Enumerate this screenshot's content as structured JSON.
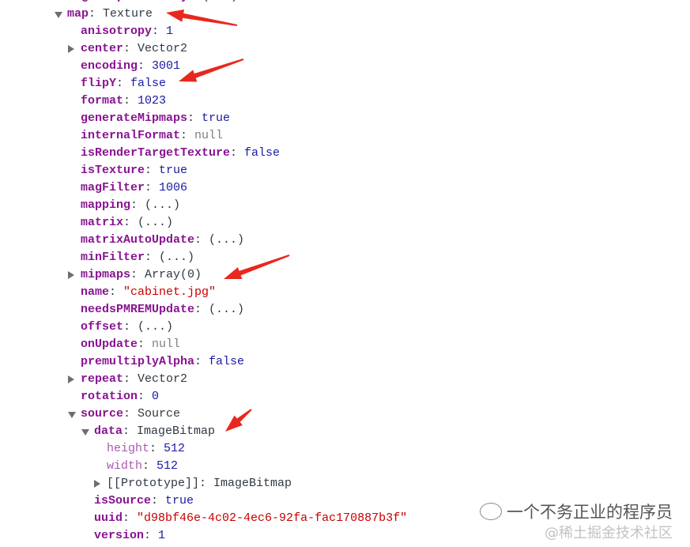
{
  "tree": [
    {
      "level": 0,
      "key": "lightMapIntensity",
      "value": "(...)",
      "type": "lazy",
      "expander": "none"
    },
    {
      "level": 0,
      "key": "map",
      "value": "Texture",
      "type": "object",
      "expander": "open"
    },
    {
      "level": 1,
      "key": "anisotropy",
      "value": "1",
      "type": "number",
      "expander": "none"
    },
    {
      "level": 1,
      "key": "center",
      "value": "Vector2",
      "type": "object",
      "expander": "closed"
    },
    {
      "level": 1,
      "key": "encoding",
      "value": "3001",
      "type": "number",
      "expander": "none"
    },
    {
      "level": 1,
      "key": "flipY",
      "value": "false",
      "type": "bool",
      "expander": "none"
    },
    {
      "level": 1,
      "key": "format",
      "value": "1023",
      "type": "number",
      "expander": "none"
    },
    {
      "level": 1,
      "key": "generateMipmaps",
      "value": "true",
      "type": "bool",
      "expander": "none"
    },
    {
      "level": 1,
      "key": "internalFormat",
      "value": "null",
      "type": "null",
      "expander": "none"
    },
    {
      "level": 1,
      "key": "isRenderTargetTexture",
      "value": "false",
      "type": "bool",
      "expander": "none"
    },
    {
      "level": 1,
      "key": "isTexture",
      "value": "true",
      "type": "bool",
      "expander": "none"
    },
    {
      "level": 1,
      "key": "magFilter",
      "value": "1006",
      "type": "number",
      "expander": "none"
    },
    {
      "level": 1,
      "key": "mapping",
      "value": "(...)",
      "type": "lazy",
      "expander": "none"
    },
    {
      "level": 1,
      "key": "matrix",
      "value": "(...)",
      "type": "lazy",
      "expander": "none"
    },
    {
      "level": 1,
      "key": "matrixAutoUpdate",
      "value": "(...)",
      "type": "lazy",
      "expander": "none"
    },
    {
      "level": 1,
      "key": "minFilter",
      "value": "(...)",
      "type": "lazy",
      "expander": "none"
    },
    {
      "level": 1,
      "key": "mipmaps",
      "value": "Array(0)",
      "type": "object",
      "expander": "closed"
    },
    {
      "level": 1,
      "key": "name",
      "value": "\"cabinet.jpg\"",
      "type": "string",
      "expander": "none"
    },
    {
      "level": 1,
      "key": "needsPMREMUpdate",
      "value": "(...)",
      "type": "lazy",
      "expander": "none"
    },
    {
      "level": 1,
      "key": "offset",
      "value": "(...)",
      "type": "lazy",
      "expander": "none"
    },
    {
      "level": 1,
      "key": "onUpdate",
      "value": "null",
      "type": "null",
      "expander": "none"
    },
    {
      "level": 1,
      "key": "premultiplyAlpha",
      "value": "false",
      "type": "bool",
      "expander": "none"
    },
    {
      "level": 1,
      "key": "repeat",
      "value": "Vector2",
      "type": "object",
      "expander": "closed"
    },
    {
      "level": 1,
      "key": "rotation",
      "value": "0",
      "type": "number",
      "expander": "none"
    },
    {
      "level": 1,
      "key": "source",
      "value": "Source",
      "type": "object",
      "expander": "open"
    },
    {
      "level": 2,
      "key": "data",
      "value": "ImageBitmap",
      "type": "object",
      "expander": "open"
    },
    {
      "level": 3,
      "key": "height",
      "value": "512",
      "type": "number",
      "expander": "none",
      "dim": true
    },
    {
      "level": 3,
      "key": "width",
      "value": "512",
      "type": "number",
      "expander": "none",
      "dim": true
    },
    {
      "level": 3,
      "key": "[[Prototype]]",
      "value": "ImageBitmap",
      "type": "object",
      "expander": "closed",
      "proto": true
    },
    {
      "level": 2,
      "key": "isSource",
      "value": "true",
      "type": "bool",
      "expander": "none"
    },
    {
      "level": 2,
      "key": "uuid",
      "value": "\"d98bf46e-4c02-4ec6-92fa-fac170887b3f\"",
      "type": "string",
      "expander": "none"
    },
    {
      "level": 2,
      "key": "version",
      "value": "1",
      "type": "number",
      "expander": "none"
    }
  ],
  "annotation_color": "#e8281e",
  "watermark": {
    "line1": "一个不务正业的程序员",
    "line2": "@稀土掘金技术社区"
  }
}
